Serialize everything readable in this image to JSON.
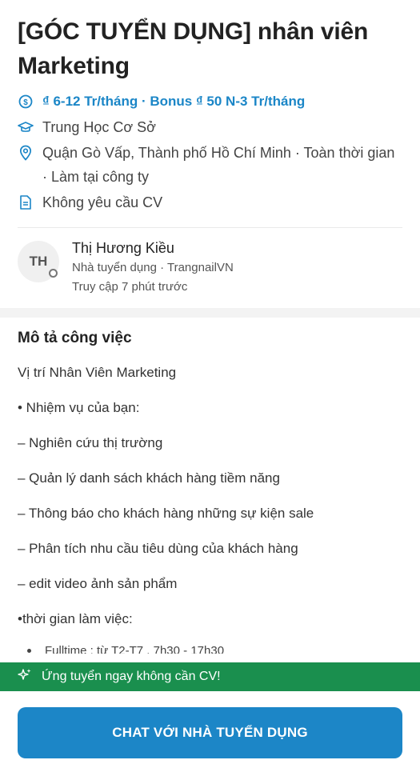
{
  "job": {
    "title": "[GÓC TUYỂN DỤNG] nhân viên Marketing",
    "salary": "₫ 6-12 Tr/tháng · Bonus ₫ 50 N-3 Tr/tháng",
    "education": "Trung Học Cơ Sở",
    "location": "Quận Gò Vấp, Thành phố Hồ Chí Minh · Toàn thời gian · Làm tại công ty",
    "cv_requirement": "Không yêu cầu CV"
  },
  "recruiter": {
    "initials": "TH",
    "name": "Thị Hương Kiều",
    "role": "Nhà tuyển dụng · TrangnailVN",
    "last_access": "Truy cập 7 phút trước"
  },
  "description": {
    "title": "Mô tả công việc",
    "lines": [
      "Vị trí Nhân Viên Marketing",
      "• Nhiệm vụ của bạn:",
      "– Nghiên cứu thị trường",
      "– Quản lý danh sách khách hàng tiềm năng",
      "– Thông báo cho khách hàng những sự kiện sale",
      "– Phân tích nhu cầu tiêu dùng của khách hàng",
      "– edit video ảnh sản phẩm",
      "•thời gian làm việc:"
    ],
    "clipped_line": "Fulltime : từ T2-T7 , 7h30 - 17h30"
  },
  "apply_banner": {
    "label": "Ứng tuyển ngay không cần CV!",
    "icon": "sparkle-icon"
  },
  "chat_button": {
    "label": "CHAT VỚI NHÀ TUYỂN DỤNG"
  },
  "colors": {
    "accent": "#1c86c7",
    "salary": "#1b86c7",
    "banner": "#1a8f4e"
  }
}
